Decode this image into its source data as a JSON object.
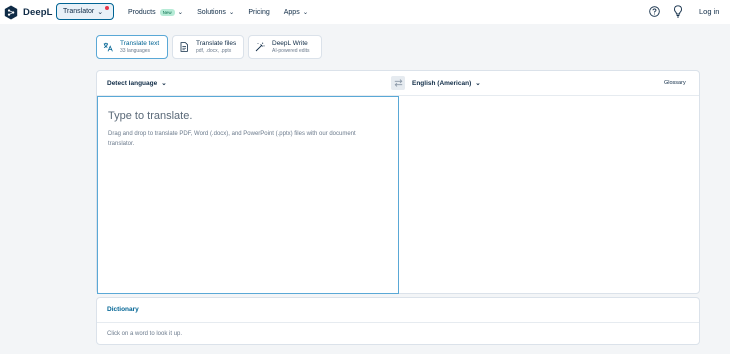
{
  "brand": {
    "name": "DeepL",
    "logo_icon": "deepl-logo-icon",
    "accent": "#006494",
    "dark": "#0f2b46"
  },
  "header": {
    "translator_button": "Translator",
    "nav": [
      {
        "label": "Products",
        "badge": "New",
        "has_dropdown": true
      },
      {
        "label": "Solutions",
        "has_dropdown": true
      },
      {
        "label": "Pricing",
        "has_dropdown": false
      },
      {
        "label": "Apps",
        "has_dropdown": true
      }
    ],
    "help_icon": "question-circle-icon",
    "tips_icon": "lightbulb-icon",
    "login": "Log in"
  },
  "modes": [
    {
      "title": "Translate text",
      "subtitle": "33 languages",
      "icon": "translate-icon",
      "active": true
    },
    {
      "title": "Translate files",
      "subtitle": "pdf, .docx, .pptx",
      "icon": "document-icon",
      "active": false
    },
    {
      "title": "DeepL Write",
      "subtitle": "AI-powered edits",
      "icon": "magic-wand-icon",
      "active": false
    }
  ],
  "translator": {
    "source_language": "Detect language",
    "target_language": "English (American)",
    "swap_icon": "swap-arrows-icon",
    "glossary": "Glossary",
    "source_placeholder": "Type to translate.",
    "source_hint": "Drag and drop to translate PDF, Word (.docx), and PowerPoint (.pptx) files with our document translator."
  },
  "dictionary": {
    "title": "Dictionary",
    "hint": "Click on a word to look it up."
  }
}
